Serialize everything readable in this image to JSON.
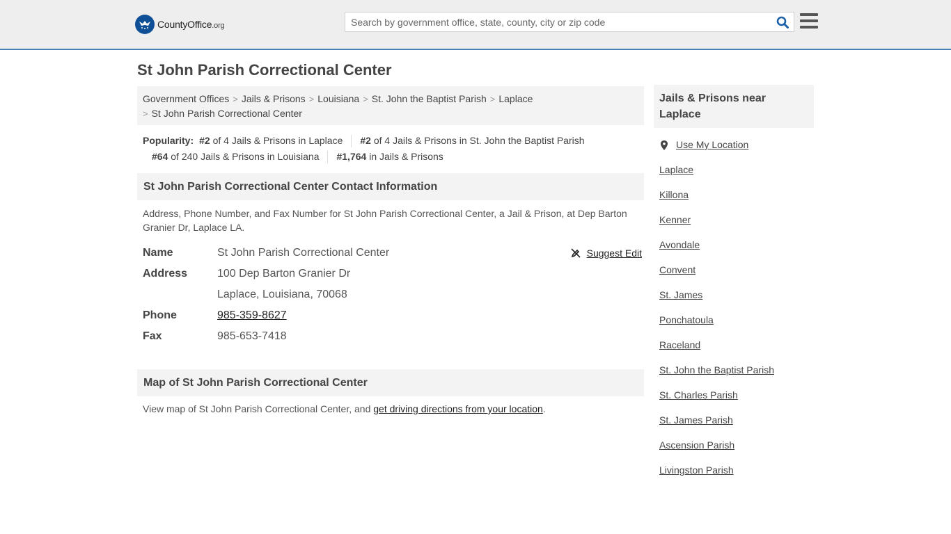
{
  "header": {
    "logo": {
      "county": "County",
      "office": "Office",
      "tld": ".org"
    },
    "search_placeholder": "Search by government office, state, county, city or zip code"
  },
  "page_title": "St John Parish Correctional Center",
  "breadcrumb": {
    "items": [
      "Government Offices",
      "Jails & Prisons",
      "Louisiana",
      "St. John the Baptist Parish",
      "Laplace"
    ],
    "current": "St John Parish Correctional Center"
  },
  "popularity": {
    "label": "Popularity:",
    "items": [
      {
        "rank": "#2",
        "text": " of 4 Jails & Prisons in Laplace"
      },
      {
        "rank": "#2",
        "text": " of 4 Jails & Prisons in St. John the Baptist Parish"
      },
      {
        "rank": "#64",
        "text": " of 240 Jails & Prisons in Louisiana"
      },
      {
        "rank": "#1,764",
        "text": " in Jails & Prisons"
      }
    ]
  },
  "contact": {
    "heading": "St John Parish Correctional Center Contact Information",
    "description": "Address, Phone Number, and Fax Number for St John Parish Correctional Center, a Jail & Prison, at Dep Barton Granier Dr, Laplace LA.",
    "suggest_edit": "Suggest Edit",
    "labels": {
      "name": "Name",
      "address": "Address",
      "phone": "Phone",
      "fax": "Fax"
    },
    "name": "St John Parish Correctional Center",
    "address_line1": "100 Dep Barton Granier Dr",
    "address_line2": "Laplace, Louisiana, 70068",
    "phone": "985-359-8627",
    "fax": "985-653-7418"
  },
  "map": {
    "heading": "Map of St John Parish Correctional Center",
    "text_before": "View map of St John Parish Correctional Center, and ",
    "link": "get driving directions from your location",
    "text_after": "."
  },
  "sidebar": {
    "heading": "Jails & Prisons near Laplace",
    "use_location": "Use My Location",
    "items": [
      "Laplace",
      "Killona",
      "Kenner",
      "Avondale",
      "Convent",
      "St. James",
      "Ponchatoula",
      "Raceland",
      "St. John the Baptist Parish",
      "St. Charles Parish",
      "St. James Parish",
      "Ascension Parish",
      "Livingston Parish"
    ]
  },
  "colors": {
    "header_bg": "#eeeeef",
    "header_border": "#4a7fb5",
    "logo_blue": "#0f4f95",
    "panel_bg": "#f3f3f4"
  }
}
